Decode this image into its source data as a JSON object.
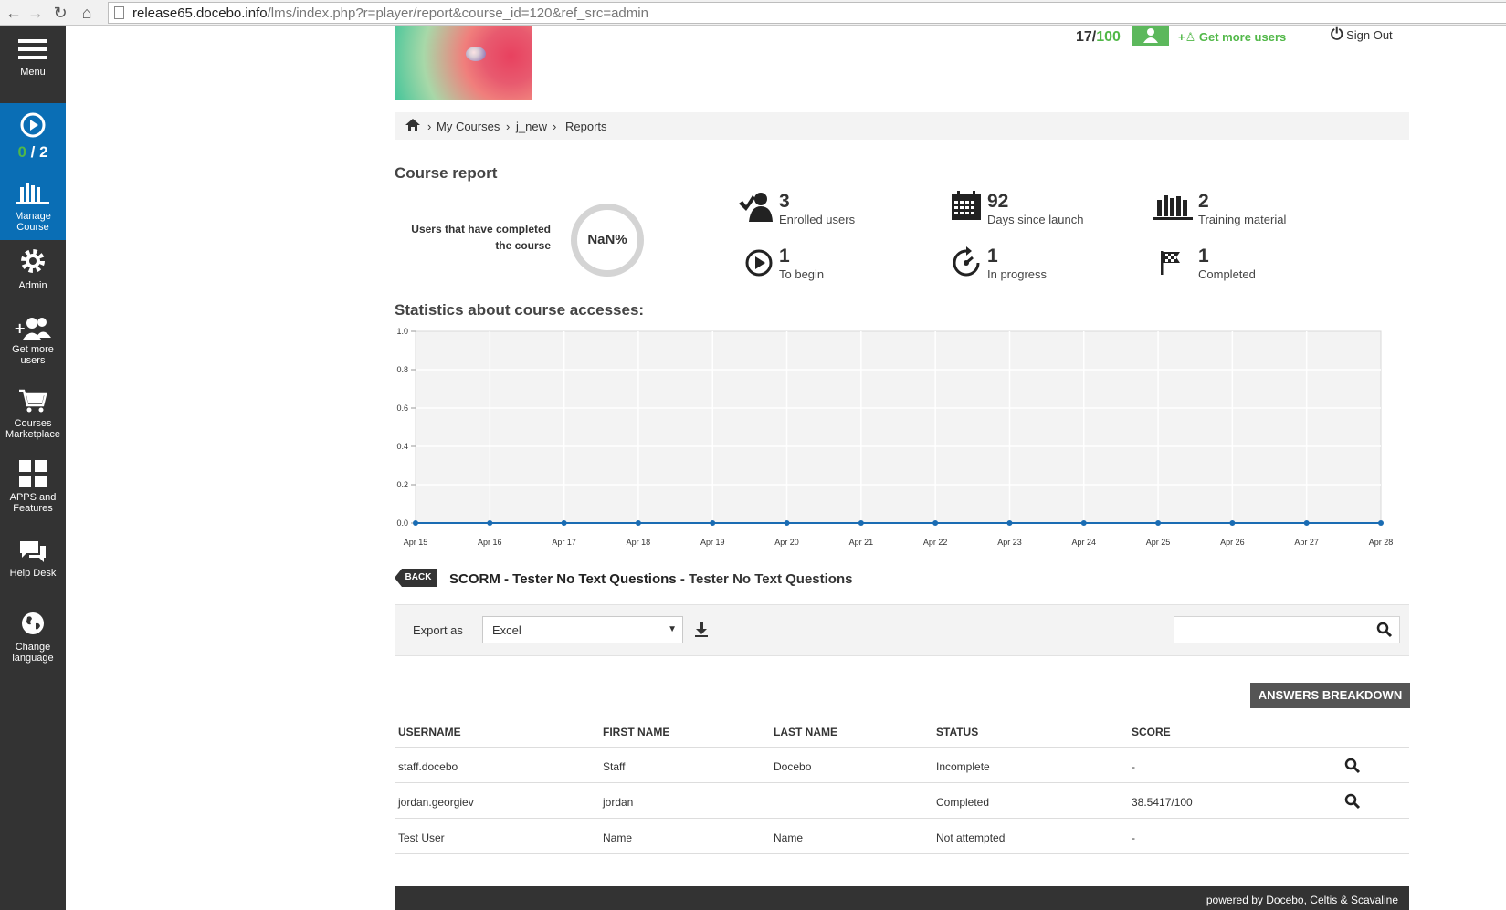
{
  "browser": {
    "url_host": "release65.docebo.info",
    "url_path": "/lms/index.php?r=player/report&course_id=120&ref_src=admin"
  },
  "sidebar": {
    "menu_label": "Menu",
    "player_progress_done": "0",
    "player_progress_sep": " / ",
    "player_progress_total": "2",
    "manage_course_label_1": "Manage",
    "manage_course_label_2": "Course",
    "admin_label": "Admin",
    "get_more_users_1": "Get more",
    "get_more_users_2": "users",
    "marketplace_1": "Courses",
    "marketplace_2": "Marketplace",
    "apps_1": "APPS and",
    "apps_2": "Features",
    "helpdesk_label": "Help Desk",
    "language_1": "Change",
    "language_2": "language"
  },
  "header": {
    "users_count": "17/",
    "users_max": "100",
    "get_more_users": "Get more users",
    "sign_out": "Sign Out"
  },
  "breadcrumb": {
    "item1": "My Courses",
    "item2": "j_new",
    "item3": "Reports",
    "sep": "›"
  },
  "course_report": {
    "title": "Course report",
    "completed_label_1": "Users that have completed",
    "completed_label_2": "the course",
    "completion_percent": "NaN%",
    "stats": {
      "enrolled_num": "3",
      "enrolled_label": "Enrolled users",
      "days_num": "92",
      "days_label": "Days since launch",
      "material_num": "2",
      "material_label": "Training material",
      "tobegin_num": "1",
      "tobegin_label": "To begin",
      "inprogress_num": "1",
      "inprogress_label": "In progress",
      "completed_num": "1",
      "completed_label": "Completed"
    }
  },
  "statistics_title": "Statistics about course accesses:",
  "chart_data": {
    "type": "line",
    "categories": [
      "Apr 15",
      "Apr 16",
      "Apr 17",
      "Apr 18",
      "Apr 19",
      "Apr 20",
      "Apr 21",
      "Apr 22",
      "Apr 23",
      "Apr 24",
      "Apr 25",
      "Apr 26",
      "Apr 27",
      "Apr 28"
    ],
    "values": [
      0,
      0,
      0,
      0,
      0,
      0,
      0,
      0,
      0,
      0,
      0,
      0,
      0,
      0
    ],
    "yticks": [
      "1.0",
      "0.8",
      "0.6",
      "0.4",
      "0.2",
      "0.0"
    ],
    "ylim": [
      0,
      1
    ],
    "grid": true,
    "colors": {
      "line": "#1a6cb3",
      "plot_bg": "#f3f3f3",
      "grid": "#ffffff"
    }
  },
  "scorm": {
    "back_label": "BACK",
    "title": "SCORM - Tester No Text Questions",
    "subtitle": " - Tester No Text Questions"
  },
  "export": {
    "label": "Export as",
    "selected": "Excel",
    "search_placeholder": ""
  },
  "answers_button": "ANSWERS BREAKDOWN",
  "table": {
    "headers": [
      "USERNAME",
      "FIRST NAME",
      "LAST NAME",
      "STATUS",
      "SCORE"
    ],
    "rows": [
      [
        "staff.docebo",
        "Staff",
        "Docebo",
        "Incomplete",
        "-"
      ],
      [
        "jordan.georgiev",
        "jordan",
        "",
        "Completed",
        "38.5417/100"
      ],
      [
        "Test User",
        "Name",
        "Name",
        "Not attempted",
        "-"
      ]
    ]
  },
  "footer": "powered by Docebo, Celtis & Scavaline",
  "colors": {
    "sidebar_bg": "#333333",
    "sidebar_active": "#0a6eb5",
    "accent_green": "#51b848"
  }
}
